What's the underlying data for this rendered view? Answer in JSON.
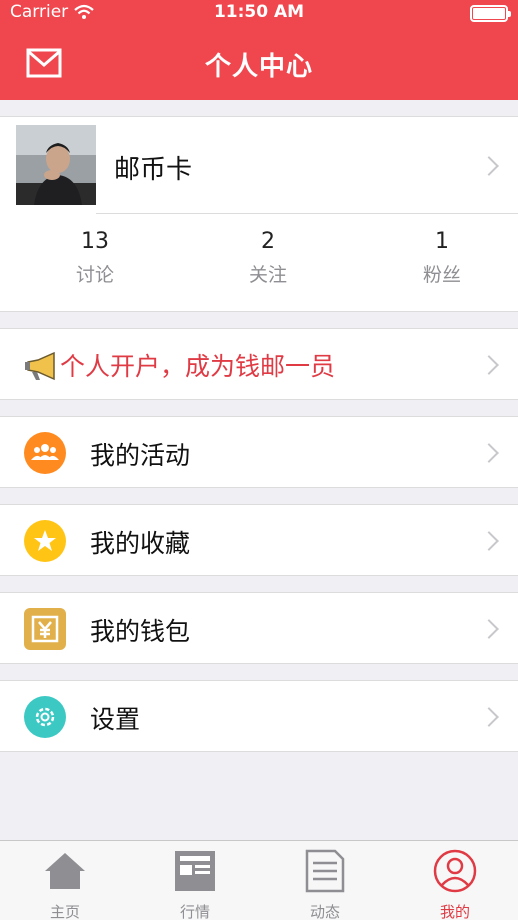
{
  "status_bar": {
    "carrier": "Carrier",
    "time": "11:50 AM"
  },
  "header": {
    "title": "个人中心",
    "mail_icon": "mail-icon"
  },
  "profile": {
    "name": "邮币卡",
    "stats": [
      {
        "value": "13",
        "label": "讨论"
      },
      {
        "value": "2",
        "label": "关注"
      },
      {
        "value": "1",
        "label": "粉丝"
      }
    ]
  },
  "promo": {
    "text": "个人开户，成为钱邮一员",
    "icon": "megaphone-icon"
  },
  "menu": [
    {
      "label": "我的活动",
      "icon": "people-icon",
      "color": "#ff8a1f"
    },
    {
      "label": "我的收藏",
      "icon": "star-icon",
      "color": "#ffc414"
    },
    {
      "label": "我的钱包",
      "icon": "wallet-icon",
      "color": "#e1b04a"
    },
    {
      "label": "设置",
      "icon": "gear-icon",
      "color": "#3cc9c4"
    }
  ],
  "tabs": [
    {
      "label": "主页",
      "icon": "home-icon"
    },
    {
      "label": "行情",
      "icon": "market-icon"
    },
    {
      "label": "动态",
      "icon": "feed-icon"
    },
    {
      "label": "我的",
      "icon": "user-icon",
      "active": true
    }
  ],
  "colors": {
    "brand": "#f0474f",
    "accent_text": "#e03b45"
  }
}
